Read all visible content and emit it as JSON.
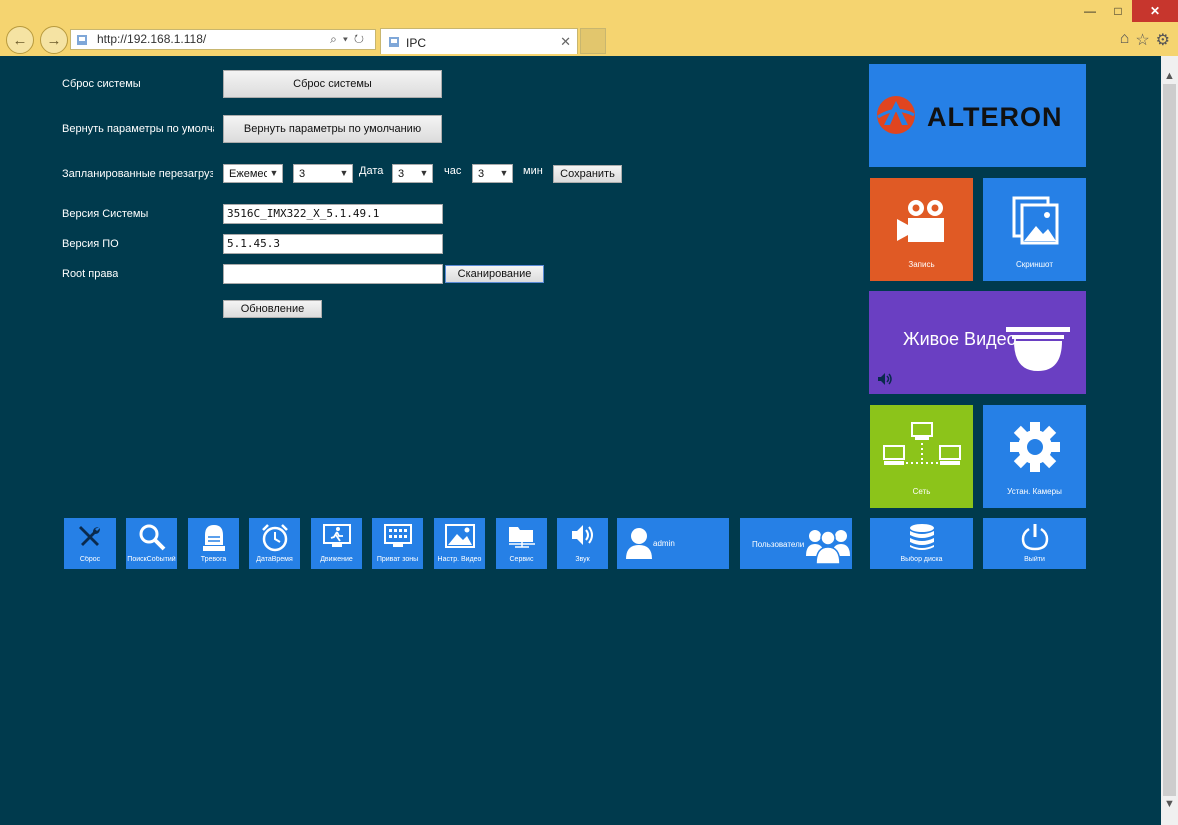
{
  "browser": {
    "window_controls": {
      "minimize": "—",
      "maximize": "□",
      "close": "✕"
    },
    "url": "http://192.168.1.118/",
    "tab_title": "IPC"
  },
  "form": {
    "reset_label": "Сброс системы",
    "reset_button": "Сброс системы",
    "defaults_label": "Вернуть параметры по умолчанию",
    "defaults_button": "Вернуть параметры по умолчанию",
    "schedule_label": "Запланированные перезагрузки",
    "schedule_freq": "Ежемесячно",
    "schedule_day": "3",
    "date_label": "Дата",
    "schedule_hour": "3",
    "hour_label": "час",
    "schedule_min": "3",
    "min_label": "мин",
    "save_button": "Сохранить",
    "system_version_label": "Версия Системы",
    "system_version": "3516C_IMX322_X_5.1.49.1",
    "software_version_label": "Версия ПО",
    "software_version": "5.1.45.3",
    "root_label": "Root права",
    "root_value": "",
    "scan_button": "Сканирование",
    "update_button": "Обновление"
  },
  "tiles": {
    "brand": "ALTERON",
    "record": "Запись",
    "screenshot": "Скриншот",
    "live_video": "Живое Видео",
    "network": "Сеть",
    "camera_settings": "Устан. Камеры",
    "disk_select": "Выбор диска",
    "logout": "Выйти"
  },
  "bottom_bar": {
    "reset": "Сброс",
    "search": "ПоискСобытий",
    "alarm": "Тревога",
    "datetime": "ДатаВремя",
    "motion": "Движение",
    "privacy": "Приват зоны",
    "video_settings": "Настр. Видео",
    "service": "Сервис",
    "sound": "Звук",
    "user": "admin",
    "users": "Пользователи"
  },
  "colors": {
    "background": "#003a4d",
    "tile_blue": "#2680e6",
    "tile_orange": "#e05a25",
    "tile_purple": "#6a3fc2",
    "tile_green": "#8cc41a"
  }
}
